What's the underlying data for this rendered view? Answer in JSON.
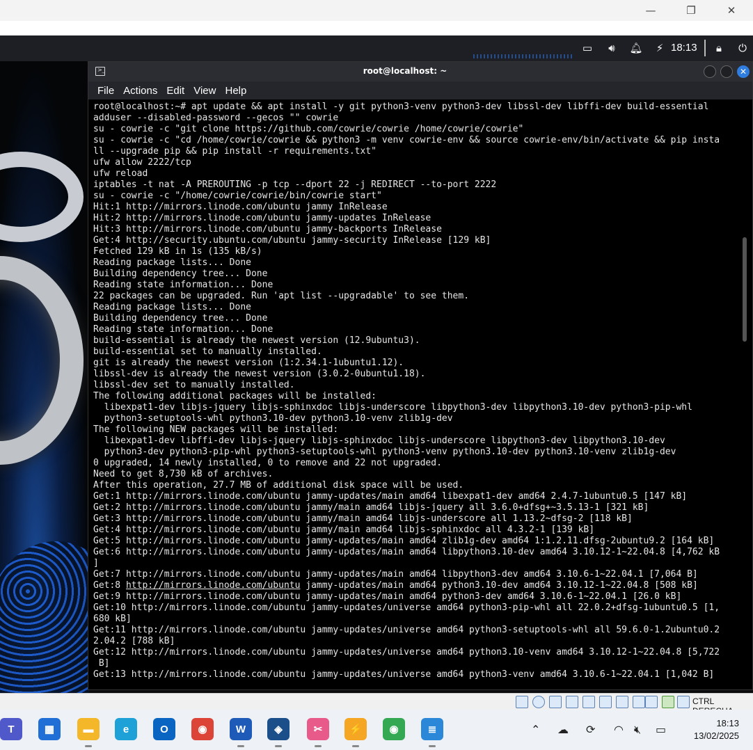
{
  "host": {
    "minimize_glyph": "—",
    "restore_glyph": "❐",
    "close_glyph": "✕"
  },
  "guest_panel": {
    "clock": "18:13",
    "icons": [
      "screen-icon",
      "volume-icon",
      "notifications-bell-icon",
      "battery-charging-icon",
      "lock-icon",
      "power-icon"
    ]
  },
  "terminal": {
    "title": "root@localhost: ~",
    "menu": [
      "File",
      "Actions",
      "Edit",
      "View",
      "Help"
    ],
    "lines": [
      "root@localhost:~# apt update && apt install -y git python3-venv python3-dev libssl-dev libffi-dev build-essential",
      "adduser --disabled-password --gecos \"\" cowrie",
      "su - cowrie -c \"git clone https://github.com/cowrie/cowrie /home/cowrie/cowrie\"",
      "su - cowrie -c \"cd /home/cowrie/cowrie && python3 -m venv cowrie-env && source cowrie-env/bin/activate && pip insta",
      "ll --upgrade pip && pip install -r requirements.txt\"",
      "ufw allow 2222/tcp",
      "ufw reload",
      "iptables -t nat -A PREROUTING -p tcp --dport 22 -j REDIRECT --to-port 2222",
      "su - cowrie -c \"/home/cowrie/cowrie/bin/cowrie start\"",
      "Hit:1 http://mirrors.linode.com/ubuntu jammy InRelease",
      "Hit:2 http://mirrors.linode.com/ubuntu jammy-updates InRelease",
      "Hit:3 http://mirrors.linode.com/ubuntu jammy-backports InRelease",
      "Get:4 http://security.ubuntu.com/ubuntu jammy-security InRelease [129 kB]",
      "Fetched 129 kB in 1s (135 kB/s)",
      "Reading package lists... Done",
      "Building dependency tree... Done",
      "Reading state information... Done",
      "22 packages can be upgraded. Run 'apt list --upgradable' to see them.",
      "Reading package lists... Done",
      "Building dependency tree... Done",
      "Reading state information... Done",
      "build-essential is already the newest version (12.9ubuntu3).",
      "build-essential set to manually installed.",
      "git is already the newest version (1:2.34.1-1ubuntu1.12).",
      "libssl-dev is already the newest version (3.0.2-0ubuntu1.18).",
      "libssl-dev set to manually installed.",
      "The following additional packages will be installed:",
      "  libexpat1-dev libjs-jquery libjs-sphinxdoc libjs-underscore libpython3-dev libpython3.10-dev python3-pip-whl",
      "  python3-setuptools-whl python3.10-dev python3.10-venv zlib1g-dev",
      "The following NEW packages will be installed:",
      "  libexpat1-dev libffi-dev libjs-jquery libjs-sphinxdoc libjs-underscore libpython3-dev libpython3.10-dev",
      "  python3-dev python3-pip-whl python3-setuptools-whl python3-venv python3.10-dev python3.10-venv zlib1g-dev",
      "0 upgraded, 14 newly installed, 0 to remove and 22 not upgraded.",
      "Need to get 8,730 kB of archives.",
      "After this operation, 27.7 MB of additional disk space will be used.",
      "Get:1 http://mirrors.linode.com/ubuntu jammy-updates/main amd64 libexpat1-dev amd64 2.4.7-1ubuntu0.5 [147 kB]",
      "Get:2 http://mirrors.linode.com/ubuntu jammy/main amd64 libjs-jquery all 3.6.0+dfsg+~3.5.13-1 [321 kB]",
      "Get:3 http://mirrors.linode.com/ubuntu jammy/main amd64 libjs-underscore all 1.13.2~dfsg-2 [118 kB]",
      "Get:4 http://mirrors.linode.com/ubuntu jammy/main amd64 libjs-sphinxdoc all 4.3.2-1 [139 kB]",
      "Get:5 http://mirrors.linode.com/ubuntu jammy-updates/main amd64 zlib1g-dev amd64 1:1.2.11.dfsg-2ubuntu9.2 [164 kB]",
      "Get:6 http://mirrors.linode.com/ubuntu jammy-updates/main amd64 libpython3.10-dev amd64 3.10.12-1~22.04.8 [4,762 kB",
      "]",
      "Get:7 http://mirrors.linode.com/ubuntu jammy-updates/main amd64 libpython3-dev amd64 3.10.6-1~22.04.1 [7,064 B]",
      "Get:8 http://mirrors.linode.com/ubuntu jammy-updates/main amd64 python3.10-dev amd64 3.10.12-1~22.04.8 [508 kB]",
      "Get:9 http://mirrors.linode.com/ubuntu jammy-updates/main amd64 python3-dev amd64 3.10.6-1~22.04.1 [26.0 kB]",
      "Get:10 http://mirrors.linode.com/ubuntu jammy-updates/universe amd64 python3-pip-whl all 22.0.2+dfsg-1ubuntu0.5 [1,",
      "680 kB]",
      "Get:11 http://mirrors.linode.com/ubuntu jammy-updates/universe amd64 python3-setuptools-whl all 59.6.0-1.2ubuntu0.2",
      "2.04.2 [788 kB]",
      "Get:12 http://mirrors.linode.com/ubuntu jammy-updates/universe amd64 python3.10-venv amd64 3.10.12-1~22.04.8 [5,722",
      " B]",
      "Get:13 http://mirrors.linode.com/ubuntu jammy-updates/universe amd64 python3-venv amd64 3.10.6-1~22.04.1 [1,042 B]"
    ],
    "link_line": {
      "prefix": "Get:8 ",
      "link": "http://mirrors.linode.com/ubuntu",
      "suffix": " jammy-updates/main amd64 python3.10-dev amd64 3.10.12-1~22.04.8 [508 kB]"
    }
  },
  "vbox_status": {
    "host_key": "CTRL DERECHA"
  },
  "taskbar": {
    "apps": [
      {
        "name": "teams-icon",
        "color": "#5059c9",
        "glyph": "T"
      },
      {
        "name": "microsoft-store-icon",
        "color": "#1f6fd6",
        "glyph": "▦"
      },
      {
        "name": "file-explorer-icon",
        "color": "#f3b729",
        "glyph": "▬"
      },
      {
        "name": "edge-icon",
        "color": "#1da1d6",
        "glyph": "e"
      },
      {
        "name": "outlook-icon",
        "color": "#0a64c2",
        "glyph": "O"
      },
      {
        "name": "chrome-icon",
        "color": "#db4437",
        "glyph": "◉"
      },
      {
        "name": "word-icon",
        "color": "#1e5bb8",
        "glyph": "W"
      },
      {
        "name": "virtualbox-icon",
        "color": "#1a4f8a",
        "glyph": "◈"
      },
      {
        "name": "snipping-tool-icon",
        "color": "#e85a8a",
        "glyph": "✂"
      },
      {
        "name": "sticky-app-icon",
        "color": "#f5a623",
        "glyph": "⚡"
      },
      {
        "name": "chrome-profile-icon",
        "color": "#34a853",
        "glyph": "◉"
      },
      {
        "name": "notepad-icon",
        "color": "#2b88d8",
        "glyph": "≣"
      }
    ],
    "time": "18:13",
    "date": "13/02/2025"
  }
}
